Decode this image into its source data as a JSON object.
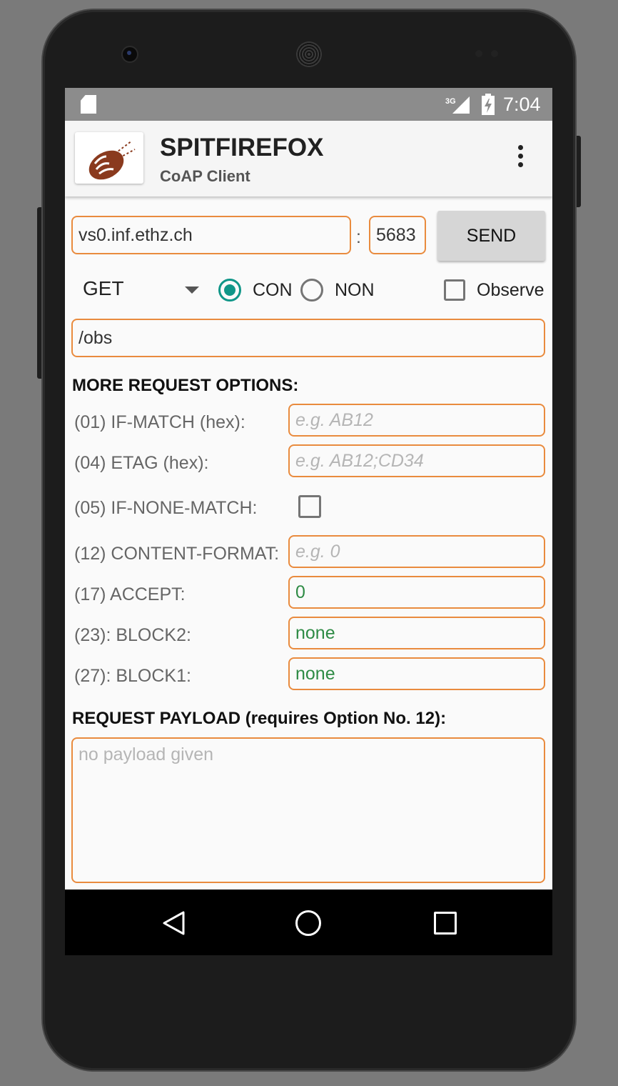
{
  "status_bar": {
    "network": "3G",
    "time": "7:04"
  },
  "app_bar": {
    "title": "SPITFIREFOX",
    "subtitle": "CoAP Client"
  },
  "request": {
    "host": "vs0.inf.ethz.ch",
    "separator": ":",
    "port": "5683",
    "send_label": "SEND",
    "method": "GET",
    "con_label": "CON",
    "non_label": "NON",
    "type_selected": "CON",
    "observe_label": "Observe",
    "observe_checked": false,
    "path": "/obs"
  },
  "options": {
    "heading": "MORE REQUEST OPTIONS:",
    "if_match_label": "(01)  IF-MATCH (hex):",
    "if_match_placeholder": "e.g. AB12",
    "etag_label": "(04)  ETAG (hex):",
    "etag_placeholder": "e.g. AB12;CD34",
    "if_none_match_label": "(05)  IF-NONE-MATCH:",
    "if_none_match_checked": false,
    "content_format_label": "(12)  CONTENT-FORMAT:",
    "content_format_placeholder": "e.g. 0",
    "accept_label": "(17)  ACCEPT:",
    "accept_value": "0",
    "block2_label": "(23): BLOCK2:",
    "block2_value": "none",
    "block1_label": "(27): BLOCK1:",
    "block1_value": "none"
  },
  "payload": {
    "heading": "REQUEST PAYLOAD (requires Option No. 12):",
    "placeholder": "no payload given"
  },
  "colors": {
    "accent": "#109688",
    "field_border": "#e98b3e",
    "value_green": "#2e8b45"
  }
}
